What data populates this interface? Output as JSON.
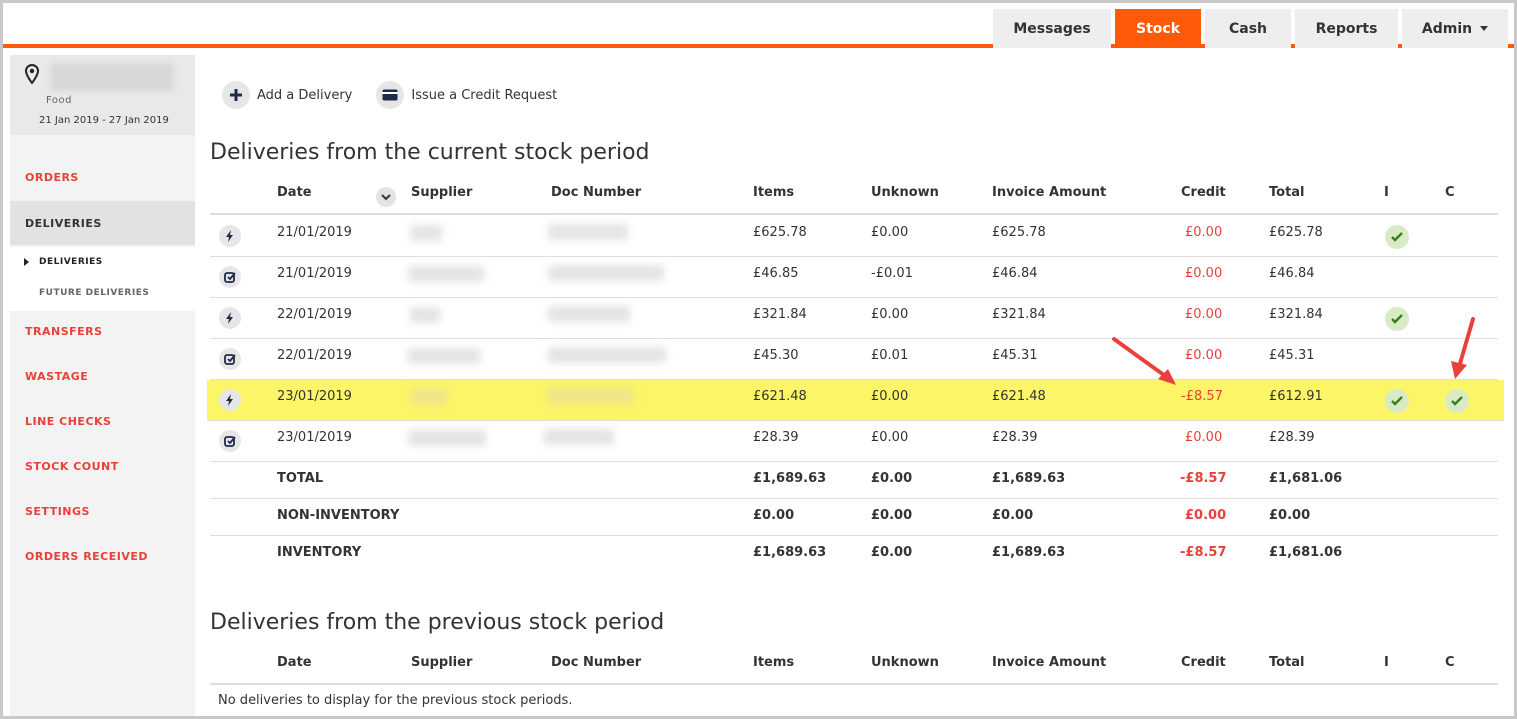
{
  "nav": {
    "tabs": [
      {
        "label": "Messages"
      },
      {
        "label": "Stock"
      },
      {
        "label": "Cash"
      },
      {
        "label": "Reports"
      },
      {
        "label": "Admin"
      }
    ]
  },
  "site": {
    "type": "Food",
    "dates": "21 Jan 2019 - 27 Jan 2019"
  },
  "sidebar": {
    "items": [
      {
        "label": "ORDERS"
      },
      {
        "label": "DELIVERIES"
      },
      {
        "label": "TRANSFERS"
      },
      {
        "label": "WASTAGE"
      },
      {
        "label": "LINE CHECKS"
      },
      {
        "label": "STOCK COUNT"
      },
      {
        "label": "SETTINGS"
      },
      {
        "label": "ORDERS RECEIVED"
      }
    ],
    "sub_items": [
      {
        "label": "DELIVERIES"
      },
      {
        "label": "FUTURE DELIVERIES"
      }
    ]
  },
  "actions": {
    "add_delivery": "Add a Delivery",
    "credit_request": "Issue a Credit Request"
  },
  "current": {
    "title": "Deliveries from the current stock period",
    "columns": {
      "date": "Date",
      "supplier": "Supplier",
      "doc": "Doc Number",
      "items": "Items",
      "unknown": "Unknown",
      "invoice": "Invoice Amount",
      "credit": "Credit",
      "total": "Total",
      "i": "I",
      "c": "C"
    },
    "rows": [
      {
        "date": "21/01/2019",
        "items": "£625.78",
        "unknown": "£0.00",
        "invoice": "£625.78",
        "credit": "£0.00",
        "total": "£625.78"
      },
      {
        "date": "21/01/2019",
        "items": "£46.85",
        "unknown": "-£0.01",
        "invoice": "£46.84",
        "credit": "£0.00",
        "total": "£46.84"
      },
      {
        "date": "22/01/2019",
        "items": "£321.84",
        "unknown": "£0.00",
        "invoice": "£321.84",
        "credit": "£0.00",
        "total": "£321.84"
      },
      {
        "date": "22/01/2019",
        "items": "£45.30",
        "unknown": "£0.01",
        "invoice": "£45.31",
        "credit": "£0.00",
        "total": "£45.31"
      },
      {
        "date": "23/01/2019",
        "items": "£621.48",
        "unknown": "£0.00",
        "invoice": "£621.48",
        "credit": "-£8.57",
        "total": "£612.91"
      },
      {
        "date": "23/01/2019",
        "items": "£28.39",
        "unknown": "£0.00",
        "invoice": "£28.39",
        "credit": "£0.00",
        "total": "£28.39"
      }
    ],
    "summary": [
      {
        "label": "TOTAL",
        "items": "£1,689.63",
        "unknown": "£0.00",
        "invoice": "£1,689.63",
        "credit": "-£8.57",
        "total": "£1,681.06"
      },
      {
        "label": "NON-INVENTORY",
        "items": "£0.00",
        "unknown": "£0.00",
        "invoice": "£0.00",
        "credit": "£0.00",
        "total": "£0.00"
      },
      {
        "label": "INVENTORY",
        "items": "£1,689.63",
        "unknown": "£0.00",
        "invoice": "£1,689.63",
        "credit": "-£8.57",
        "total": "£1,681.06"
      }
    ]
  },
  "previous": {
    "title": "Deliveries from the previous stock period",
    "empty": "No deliveries to display for the previous stock periods."
  },
  "colors": {
    "accent": "#ff5a0a",
    "link_red": "#e8413a",
    "highlight": "#fbf567",
    "check_bg": "#d9ebc4",
    "check": "#3a7d1e",
    "annotation_arrow": "#e8413a"
  },
  "icons": [
    "location-pin-icon",
    "plus-icon",
    "credit-card-icon",
    "lightning-icon",
    "edit-check-icon",
    "checkmark-icon",
    "chevron-down-icon"
  ]
}
